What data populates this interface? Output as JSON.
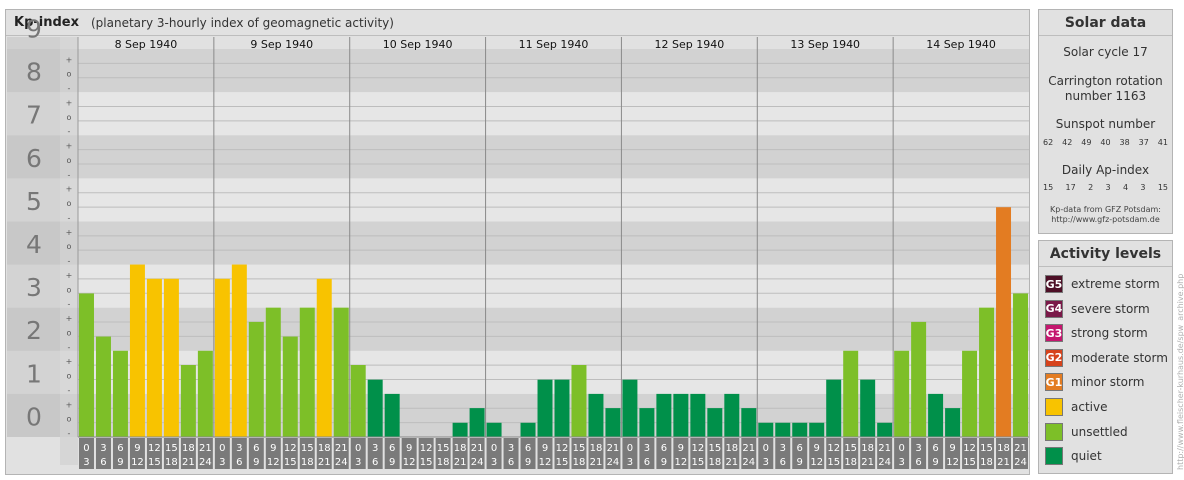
{
  "kp_panel": {
    "title": "Kp-index",
    "subtitle": "(planetary 3-hourly index of geomagnetic activity)"
  },
  "chart_data": {
    "type": "bar",
    "title": "Kp-index",
    "subtitle": "(planetary 3-hourly index of geomagnetic activity)",
    "ylim": [
      0,
      9
    ],
    "y_ticks": [
      "0",
      "1",
      "2",
      "3",
      "4",
      "5",
      "6",
      "7",
      "8",
      "9"
    ],
    "minor_ticks": [
      "-",
      "o",
      "+"
    ],
    "days": [
      "8 Sep 1940",
      "9 Sep 1940",
      "10 Sep 1940",
      "11 Sep 1940",
      "12 Sep 1940",
      "13 Sep 1940",
      "14 Sep 1940"
    ],
    "slots": [
      [
        "0",
        "3"
      ],
      [
        "3",
        "6"
      ],
      [
        "6",
        "9"
      ],
      [
        "9",
        "12"
      ],
      [
        "12",
        "15"
      ],
      [
        "15",
        "18"
      ],
      [
        "18",
        "21"
      ],
      [
        "21",
        "24"
      ]
    ],
    "values": [
      [
        3.33,
        2.33,
        2.0,
        4.0,
        3.67,
        3.67,
        1.67,
        2.0
      ],
      [
        3.67,
        4.0,
        2.67,
        3.0,
        2.33,
        3.0,
        3.67,
        3.0
      ],
      [
        1.67,
        1.33,
        1.0,
        0.0,
        0.0,
        0.0,
        0.33,
        0.67
      ],
      [
        0.33,
        0.0,
        0.33,
        1.33,
        1.33,
        1.67,
        1.0,
        0.67
      ],
      [
        1.33,
        0.67,
        1.0,
        1.0,
        1.0,
        0.67,
        1.0,
        0.67
      ],
      [
        0.33,
        0.33,
        0.33,
        0.33,
        1.33,
        2.0,
        1.33,
        0.33
      ],
      [
        2.0,
        2.67,
        1.0,
        0.67,
        2.0,
        3.0,
        5.33,
        3.33
      ]
    ],
    "grid": true,
    "legend_position": "right"
  },
  "solar": {
    "title": "Solar data",
    "cycle": "Solar cycle 17",
    "carrington_line1": "Carrington rotation",
    "carrington_line2": "number 1163",
    "sunspot_label": "Sunspot number",
    "sunspot": [
      "62",
      "42",
      "49",
      "40",
      "38",
      "37",
      "41"
    ],
    "ap_label": "Daily Ap-index",
    "ap": [
      "15",
      "17",
      "2",
      "3",
      "4",
      "3",
      "15"
    ],
    "credit1": "Kp-data from GFZ Potsdam:",
    "credit2": "http://www.gfz-potsdam.de"
  },
  "activity": {
    "title": "Activity levels",
    "items": [
      {
        "code": "G5",
        "label": "extreme storm",
        "color": "#4d0f26"
      },
      {
        "code": "G4",
        "label": "severe storm",
        "color": "#7a1848"
      },
      {
        "code": "G3",
        "label": "strong storm",
        "color": "#c4166e"
      },
      {
        "code": "G2",
        "label": "moderate storm",
        "color": "#d6431c"
      },
      {
        "code": "G1",
        "label": "minor storm",
        "color": "#e37c22"
      },
      {
        "code": "",
        "label": "active",
        "color": "#f8c300"
      },
      {
        "code": "",
        "label": "unsettled",
        "color": "#7dbf28"
      },
      {
        "code": "",
        "label": "quiet",
        "color": "#00904a"
      }
    ]
  },
  "watermark": "http://www.fleischer-kurhaus.de/spw_archive.php"
}
